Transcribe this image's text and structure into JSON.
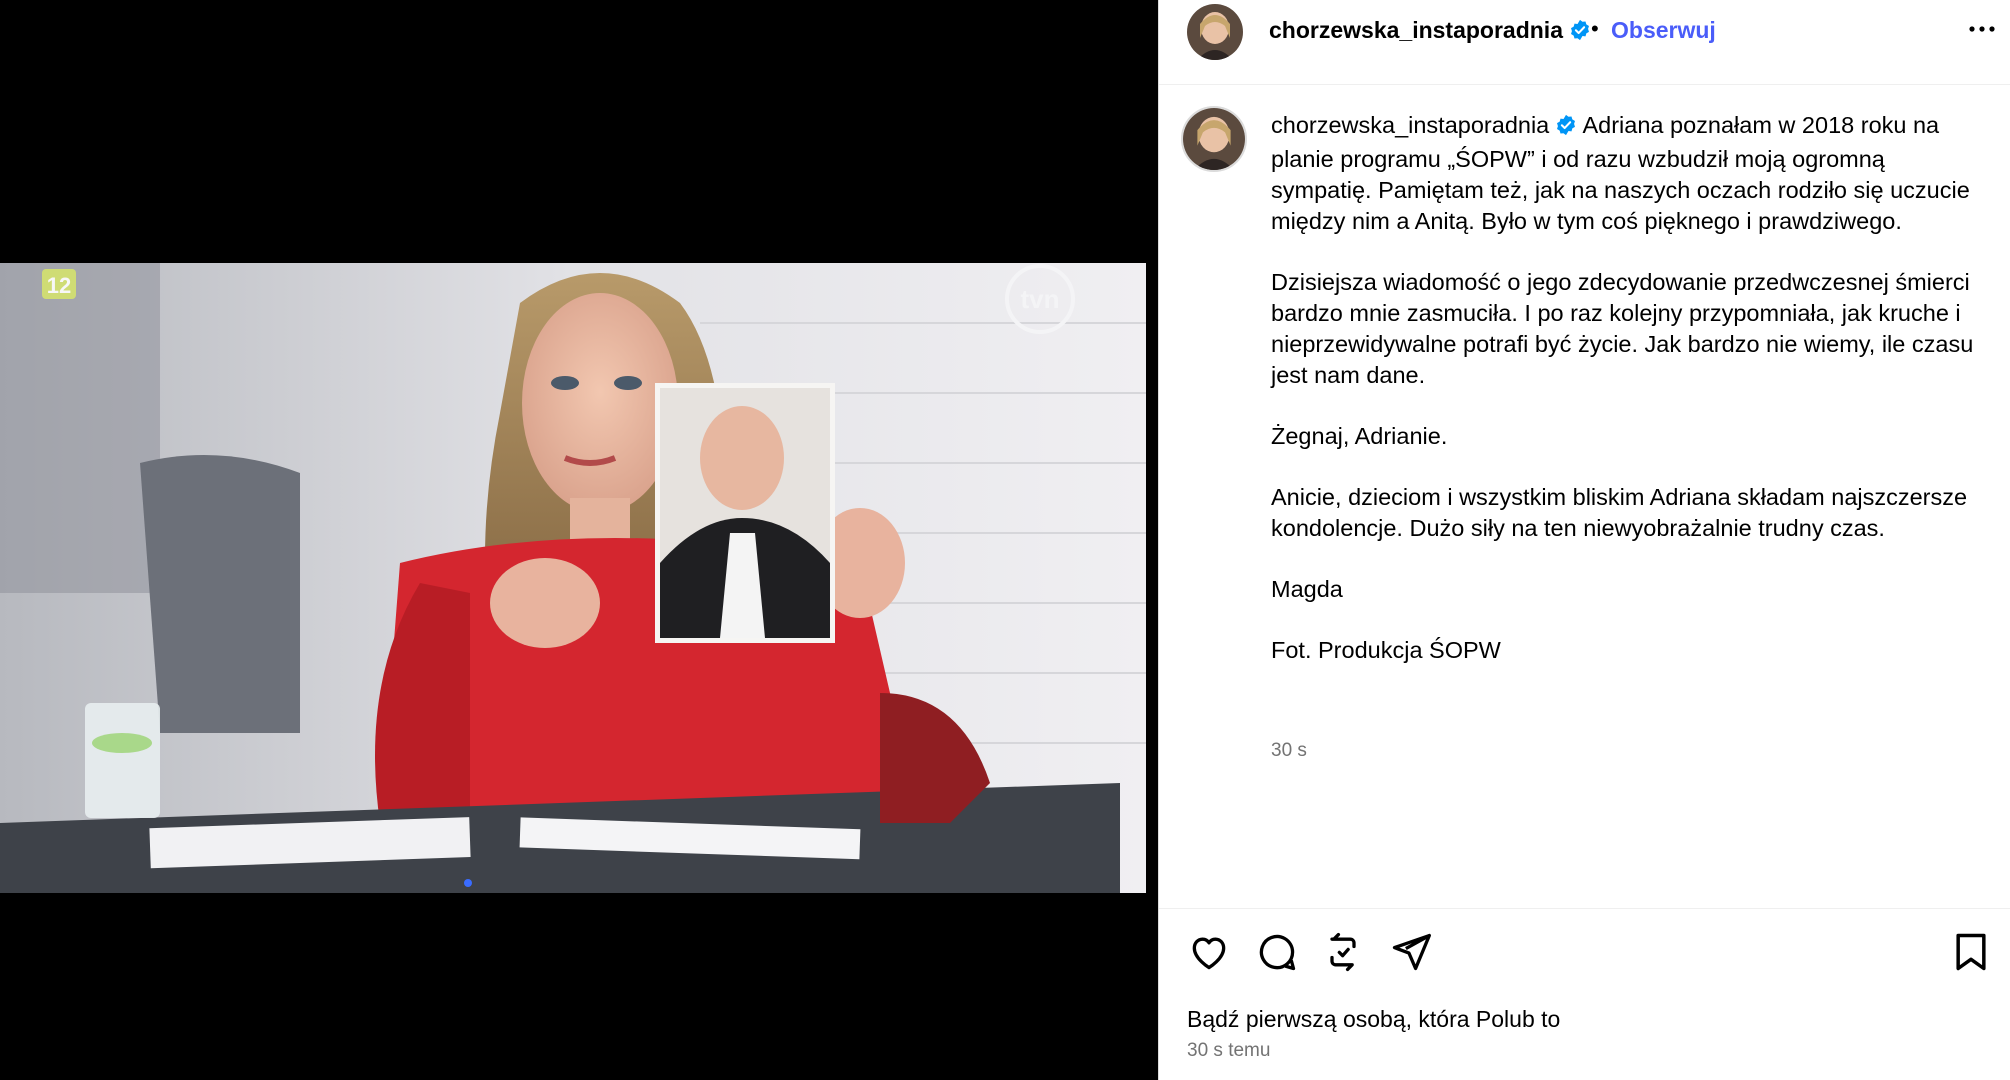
{
  "media": {
    "tv_channel_badge": "12",
    "tv_logo": "tvn"
  },
  "post": {
    "username": "chorzewska_instaporadnia",
    "follow_label": "Obserwuj",
    "caption_paragraphs": [
      "Adriana poznałam w 2018 roku na planie programu „ŚOPW” i od razu wzbudził moją ogromną sympatię. Pamiętam też, jak na naszych oczach rodziło się uczucie między nim a Anitą. Było w tym coś pięknego i prawdziwego.",
      "Dzisiejsza wiadomość o jego zdecydowanie przedwczesnej śmierci bardzo mnie zasmuciła. I po raz kolejny przypomniała, jak kruche i nieprzewidywalne potrafi być życie. Jak bardzo nie wiemy, ile czasu jest nam dane.",
      "Żegnaj, Adrianie.",
      "Anicie, dzieciom i wszystkim bliskim Adriana składam najszczersze kondolencje. Dużo siły na ten niewyobrażalnie trudny czas.",
      "Magda",
      "Fot. Produkcja ŚOPW"
    ],
    "caption_time": "30 s",
    "likes_text": "Bądź pierwszą osobą, która Polub to",
    "posted_ago": "30 s temu"
  },
  "icons": {
    "verified": "verified-badge-icon",
    "more": "more-options-icon",
    "like": "heart-icon",
    "comment": "comment-icon",
    "repost": "repost-icon",
    "share": "share-icon",
    "save": "bookmark-icon"
  },
  "colors": {
    "accent": "#4a5df9",
    "verified": "#0095f6",
    "muted": "#737373"
  }
}
